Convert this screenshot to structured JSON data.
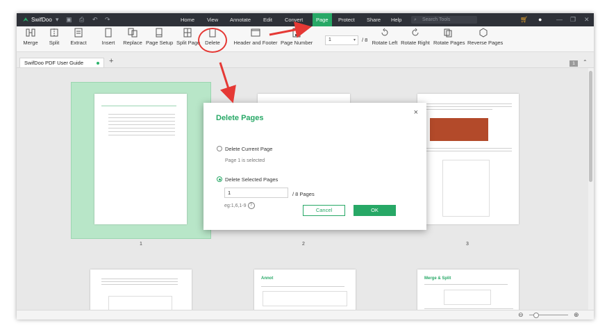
{
  "titlebar": {
    "app_name": "SwifDoo",
    "menus": [
      "Home",
      "View",
      "Annotate",
      "Edit",
      "Convert",
      "Page",
      "Protect",
      "Share",
      "Help"
    ],
    "active_menu": "Page",
    "search_placeholder": "Search Tools"
  },
  "toolbar": {
    "tools": [
      {
        "label": "Merge",
        "icon": "merge-icon"
      },
      {
        "label": "Split",
        "icon": "split-icon"
      },
      {
        "label": "Extract",
        "icon": "extract-icon"
      },
      {
        "label": "Insert",
        "icon": "insert-icon"
      },
      {
        "label": "Replace",
        "icon": "replace-icon"
      },
      {
        "label": "Page Setup",
        "icon": "page-setup-icon"
      },
      {
        "label": "Split Page",
        "icon": "split-page-icon"
      },
      {
        "label": "Delete",
        "icon": "delete-page-icon"
      },
      {
        "label": "Header and Footer",
        "icon": "header-footer-icon"
      },
      {
        "label": "Page Number",
        "icon": "page-number-icon"
      },
      {
        "label": "Rotate Left",
        "icon": "rotate-left-icon"
      },
      {
        "label": "Rotate Right",
        "icon": "rotate-right-icon"
      },
      {
        "label": "Rotate Pages",
        "icon": "rotate-pages-icon"
      },
      {
        "label": "Reverse Pages",
        "icon": "reverse-pages-icon"
      }
    ],
    "page_value": "1",
    "page_total": "/ 8"
  },
  "tabbar": {
    "tab_label": "SwifDoo PDF User Guide",
    "add_tab": "+",
    "page_badge": "1"
  },
  "thumbnails": {
    "page_numbers": [
      "1",
      "2",
      "3"
    ],
    "page5_heading": "Annot",
    "page6_heading": "Merge & Split"
  },
  "dialog": {
    "title": "Delete Pages",
    "close": "×",
    "option_current": "Delete Current Page",
    "current_note": "Page 1 is selected",
    "option_selected": "Delete Selected Pages",
    "input_value": "1",
    "pages_suffix": "/ 8 Pages",
    "example": "eg:1,6,1-9",
    "help": "?",
    "cancel": "Cancel",
    "ok": "OK"
  },
  "colors": {
    "accent": "#27a866",
    "titlebar": "#2e3138",
    "annotation": "#e53935"
  }
}
